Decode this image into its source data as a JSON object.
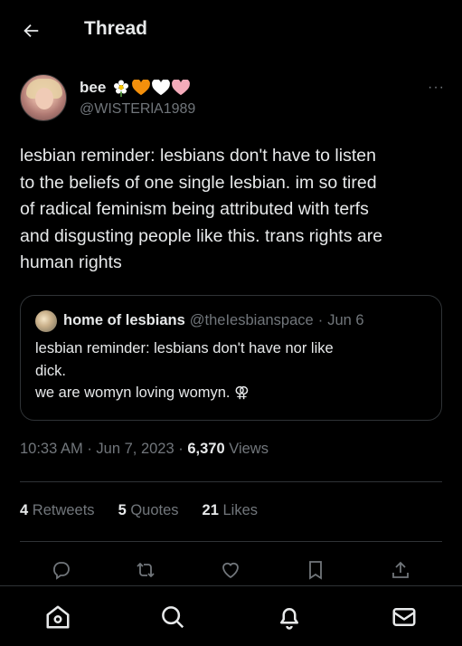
{
  "header": {
    "title": "Thread"
  },
  "author": {
    "display_name": "bee",
    "emojis": [
      "flower-icon",
      "orange-heart-icon",
      "white-heart-icon",
      "pink-heart-icon"
    ],
    "username": "@WISTERlA1989",
    "more_label": "···"
  },
  "tweet": {
    "text": "lesbian reminder: lesbians don't have to listen\nto the beliefs of one single lesbian. im so tired\nof radical feminism being attributed with terfs\nand disgusting people like this. trans rights are\nhuman rights"
  },
  "quote": {
    "name": "home of lesbians",
    "handle": "@theIesbianspace",
    "separator": "·",
    "date": "Jun 6",
    "text": "lesbian reminder: lesbians don't have nor like\ndick.\nwe are womyn loving womyn. ⚢"
  },
  "meta": {
    "time": "10:33 AM",
    "separator1": "·",
    "date": "Jun 7, 2023",
    "separator2": "·",
    "views_count": "6,370",
    "views_label": "Views"
  },
  "stats": {
    "retweets_count": "4",
    "retweets_label": "Retweets",
    "quotes_count": "5",
    "quotes_label": "Quotes",
    "likes_count": "21",
    "likes_label": "Likes"
  },
  "actions": [
    "reply-icon",
    "retweet-icon",
    "like-icon",
    "bookmark-icon",
    "share-icon"
  ],
  "bottom_nav": [
    "home-icon",
    "search-icon",
    "notifications-icon",
    "messages-icon"
  ],
  "colors": {
    "background": "#000000",
    "text": "#e7e9ea",
    "secondary": "#71767b",
    "border": "#2f3336",
    "orange_heart": "#f4900c",
    "white_heart": "#ffffff",
    "pink_heart": "#f4abba"
  }
}
